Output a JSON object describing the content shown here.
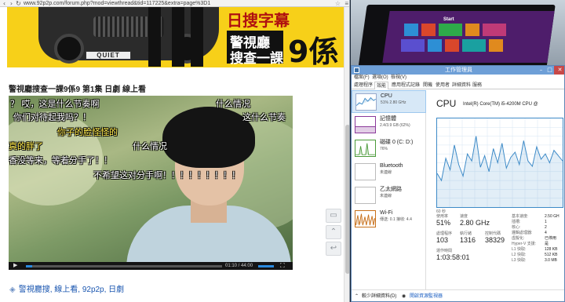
{
  "browser": {
    "url": "www.92p2p.com/forum.php?mod=viewthread&tid=117225&extra=page%3D1",
    "banner": {
      "title_top": "日搜字幕",
      "title_line1": "警視廳",
      "title_line2": "搜查一課",
      "episode": "9係",
      "plate": "QUIET"
    },
    "video_title": "警視廳搜查一課9係9 第1集 日劇 線上看",
    "subtitles": [
      {
        "text": "？   哎，这是什么节奏啊",
        "color": "white"
      },
      {
        "text": "什么情况",
        "color": "white"
      },
      {
        "text": "你们对待起我吗？！",
        "color": "white"
      },
      {
        "text": "这什么节奏",
        "color": "white"
      },
      {
        "text": "你子的脸怪怪的",
        "color": "yellow"
      },
      {
        "text": "真的胖了",
        "color": "yellow"
      },
      {
        "text": "什么情况",
        "color": "white"
      },
      {
        "text": "香没等来，等着分手了！！",
        "color": "white"
      },
      {
        "text": "不希望这对分手啊！！！！！！！！！",
        "color": "white"
      }
    ],
    "player": {
      "time": "01:10 / 44:00",
      "progress": 0.03
    },
    "tags": "警視廳搜, 線上看, 92p2p, 日劇"
  },
  "desktop": {
    "start_label": "Start"
  },
  "taskmgr": {
    "title": "工作管理員",
    "menu": [
      "檔案(F)",
      "選項(O)",
      "檢視(V)"
    ],
    "tabs": [
      "處理程序",
      "效能",
      "應用程式記錄",
      "開機",
      "使用者",
      "詳細資料",
      "服務"
    ],
    "active_tab_index": 1,
    "resources": [
      {
        "name": "CPU",
        "val1": "51%  2.80 GHz",
        "val2": ""
      },
      {
        "name": "記憶體",
        "val1": "2.4/3.9 GB (62%)",
        "val2": ""
      },
      {
        "name": "磁碟 0 (C: D:)",
        "val1": "76%",
        "val2": ""
      },
      {
        "name": "Bluetooth",
        "val1": "未連線",
        "val2": ""
      },
      {
        "name": "乙太網路",
        "val1": "未連線",
        "val2": ""
      },
      {
        "name": "Wi-Fi",
        "val1": "傳送: 0.1  接收: 4.4",
        "val2": ""
      }
    ],
    "detail": {
      "title": "CPU",
      "model": "Intel(R) Core(TM) i5-4200M CPU @",
      "graph_label": "60 秒",
      "stats": {
        "usage_label": "使用率",
        "usage": "51%",
        "speed_label": "速度",
        "speed": "2.80 GHz",
        "processes_label": "處理程序",
        "processes": "103",
        "threads_label": "執行緒",
        "threads": "1316",
        "handles_label": "控制代碼",
        "handles": "38329",
        "uptime_label": "運作時間",
        "uptime": "1:03:58:01"
      },
      "right": [
        {
          "label": "基本速度:",
          "value": "2.50 GH"
        },
        {
          "label": "插槽:",
          "value": "1"
        },
        {
          "label": "核心:",
          "value": "2"
        },
        {
          "label": "邏輯處理器:",
          "value": "4"
        },
        {
          "label": "虛擬化:",
          "value": "已停用"
        },
        {
          "label": "Hyper-V 支援:",
          "value": "是"
        },
        {
          "label": "L1 快取:",
          "value": "128 KB"
        },
        {
          "label": "L2 快取:",
          "value": "512 KB"
        },
        {
          "label": "L3 快取:",
          "value": "3.0 MB"
        }
      ]
    },
    "footer": {
      "fewer": "較少詳細資料(D)",
      "open_monitor": "開啟資源監視器"
    },
    "cpu_graph": [
      38,
      30,
      55,
      42,
      70,
      48,
      35,
      60,
      52,
      80,
      45,
      58,
      40,
      66,
      50,
      72,
      44,
      56,
      62,
      48,
      75,
      52,
      46,
      68,
      54,
      60,
      50,
      64,
      58,
      52
    ]
  }
}
